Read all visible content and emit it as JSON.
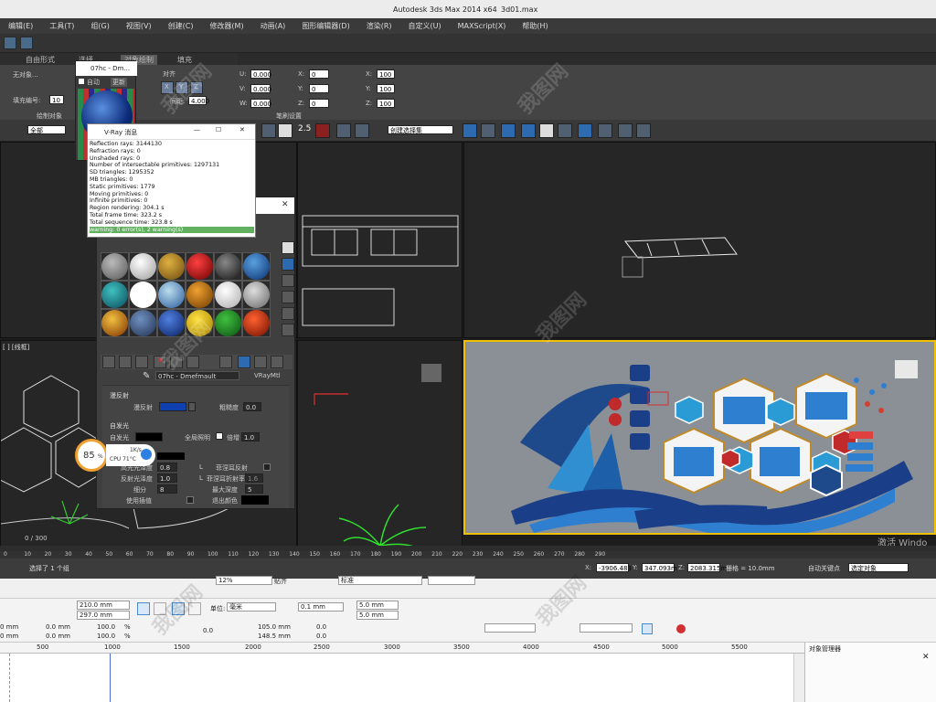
{
  "window": {
    "title": "Autodesk 3ds Max  2014 x64",
    "file": "3d01.max"
  },
  "menu": [
    "编辑(E)",
    "工具(T)",
    "组(G)",
    "视图(V)",
    "创建(C)",
    "修改器(M)",
    "动画(A)",
    "图形编辑器(D)",
    "渲染(R)",
    "自定义(U)",
    "MAXScript(X)",
    "帮助(H)"
  ],
  "ribbon": {
    "tabs": [
      "自由形式",
      "选择",
      "对象绘制",
      "填充"
    ],
    "no_object": "无对象...",
    "fill_number_label": "填充编号:",
    "fill_number": "10",
    "draw_object": "绘制对象",
    "align_label": "对齐",
    "spacing_label": "间距:",
    "spacing_value": "4.000",
    "u_label": "U:",
    "v_label": "V:",
    "w_label": "W:",
    "x_label": "X:",
    "y_label": "Y:",
    "z_label": "Z:",
    "uvw_values": [
      "0.000",
      "0.000",
      "0.000"
    ],
    "xyz_values": [
      "0",
      "0",
      "0"
    ],
    "scale_values": [
      "100",
      "100",
      "100"
    ],
    "brush_settings": "笔刷设置"
  },
  "toolbar": {
    "filter": "全部",
    "selection_set": "创建选择集",
    "snap_angle": "2.5"
  },
  "vray": {
    "title": "V-Ray 消息",
    "lines": [
      "Reflection rays: 3144130",
      "Refraction rays: 0",
      "Unshaded rays: 0",
      "Number of intersectable primitives: 1297131",
      "  SD triangles: 1295352",
      "  MB triangles: 0",
      "  Static primitives: 1779",
      "  Moving primitives: 0",
      "  Infinite primitives: 0",
      "Region rendering: 304.1 s",
      "Total frame time: 323.2 s",
      "Total sequence time: 323.8 s"
    ],
    "warning": "warning: 0 error(s), 2 warning(s)"
  },
  "mat_thumb": {
    "title": "07hc - Dm...",
    "auto": "自动",
    "update": "更新"
  },
  "mated": {
    "material_name": "07hc - Dmefmault",
    "material_type": "VRayMtl",
    "diffuse_section": "漫反射",
    "diffuse_label": "漫反射",
    "roughness_label": "粗糙度",
    "roughness_value": "0.0",
    "self_illum_section": "自发光",
    "self_illum_label": "自发光",
    "global_illum_label": "全局照明",
    "multiplier_label": "倍增",
    "multiplier_value": "1.0",
    "reflect_section": "反射",
    "hilight_gloss_label": "高光光泽度",
    "hilight_gloss_value": "0.8",
    "refl_gloss_label": "反射光泽度",
    "refl_gloss_value": "1.0",
    "subdivs_label": "细分",
    "subdivs_value": "8",
    "use_interp_label": "使用插值",
    "fresnel_label": "菲涅耳反射",
    "fresnel_ior_label": "菲涅耳折射率",
    "fresnel_ior_value": "1.6",
    "max_depth_label": "最大深度",
    "max_depth_value": "5",
    "exit_color_label": "退出颜色",
    "lock_label": "L"
  },
  "cpu_widget": {
    "percent": "85",
    "percent_unit": "%",
    "net": "1K/s",
    "cpu": "CPU 71°C"
  },
  "viewport_left_label": "[ ] [线框]",
  "frame_counter": "0 / 300",
  "activate_windows": "激活 Windo",
  "timeline_ticks": [
    "0",
    "10",
    "20",
    "30",
    "40",
    "50",
    "60",
    "70",
    "80",
    "90",
    "100",
    "110",
    "120",
    "130",
    "140",
    "150",
    "160",
    "170",
    "180",
    "190",
    "200",
    "210",
    "220",
    "230",
    "240",
    "250",
    "260",
    "270",
    "280",
    "290"
  ],
  "status": {
    "selected": "选择了 1 个组",
    "x": "-3906.483",
    "y": "347.093m",
    "z": "2083.315m",
    "grid": "栅格 = 10.0mm",
    "autokey": "自动关键点",
    "set_key": "选定对象"
  },
  "lower_app": {
    "zoom": "12%",
    "snap_label": "贴齐",
    "style_label": "标准",
    "page_width": "210.0 mm",
    "page_height": "297.0 mm",
    "units_label": "单位:",
    "units": "毫米",
    "nudge": "0.1 mm",
    "dup_x": "5.0 mm",
    "dup_y": "5.0 mm",
    "x_val": "0 mm",
    "y_val": "0 mm",
    "w_val": "0.0 mm",
    "h_val": "0.0 mm",
    "scale_w": "100.0",
    "scale_h": "100.0",
    "pct": "%",
    "rot": "0.0",
    "pos_x": "105.0 mm",
    "pos_y": "148.5 mm",
    "misc1": "0.0",
    "misc2": "0.0",
    "ruler_marks": [
      "500",
      "1000",
      "1500",
      "2000",
      "2500",
      "3000",
      "3500",
      "4000",
      "4500",
      "5000",
      "5500"
    ],
    "object_manager": "对象管理器"
  },
  "watermark": "我图网"
}
